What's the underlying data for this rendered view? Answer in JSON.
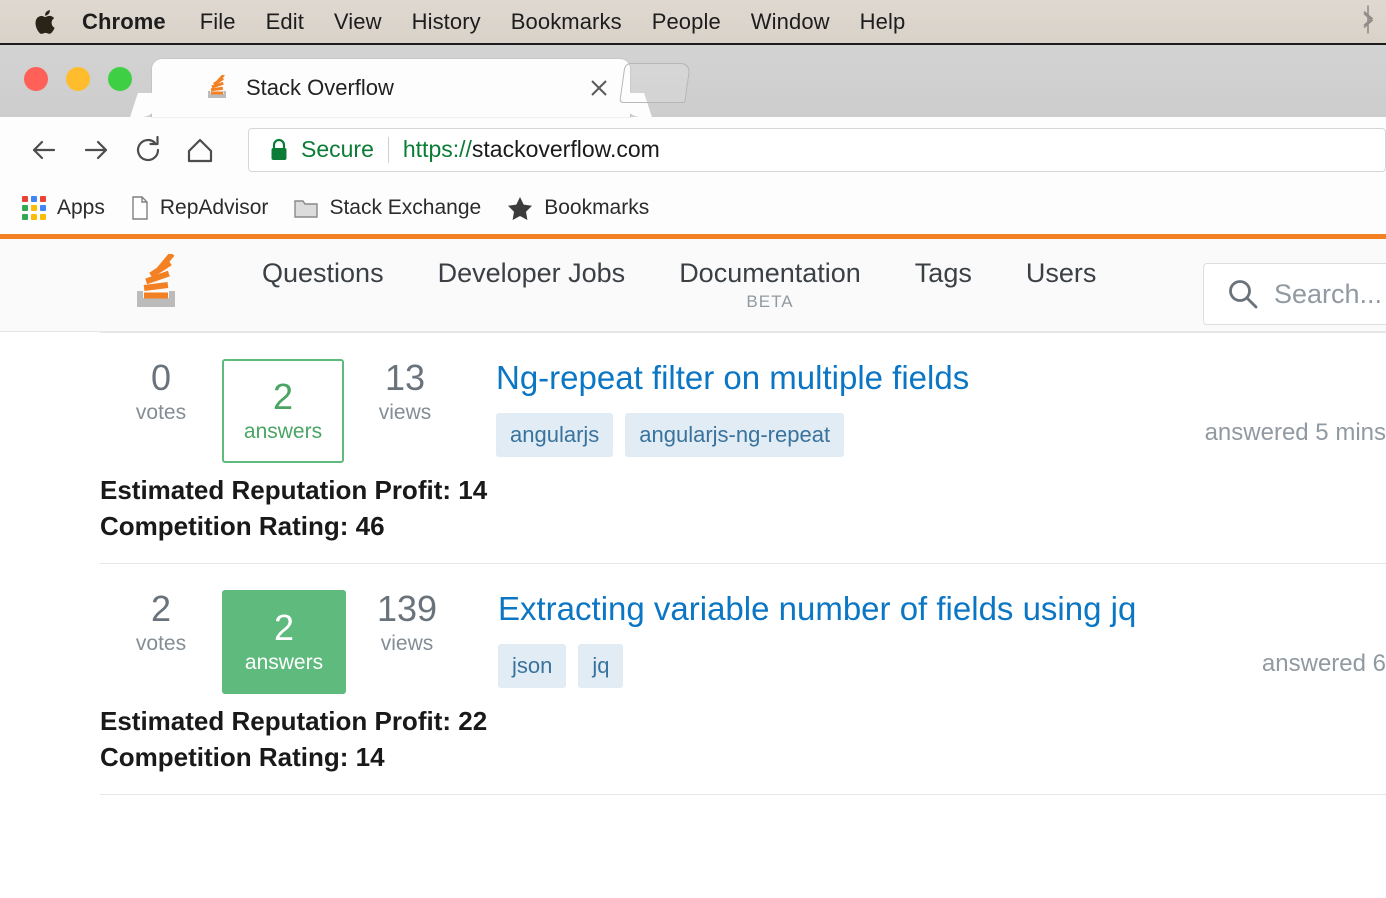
{
  "os_menubar": {
    "apple_icon": "apple-logo",
    "items": [
      {
        "label": "Chrome",
        "bold": true
      },
      {
        "label": "File",
        "bold": false
      },
      {
        "label": "Edit",
        "bold": false
      },
      {
        "label": "View",
        "bold": false
      },
      {
        "label": "History",
        "bold": false
      },
      {
        "label": "Bookmarks",
        "bold": false
      },
      {
        "label": "People",
        "bold": false
      },
      {
        "label": "Window",
        "bold": false
      },
      {
        "label": "Help",
        "bold": false
      }
    ],
    "status_icon": "bluetooth-icon"
  },
  "browser": {
    "tab": {
      "title": "Stack Overflow",
      "favicon": "stack-overflow-favicon",
      "close_icon": "close-icon"
    },
    "new_tab_label": "",
    "toolbar": {
      "back_icon": "back-arrow-icon",
      "forward_icon": "forward-arrow-icon",
      "reload_icon": "reload-icon",
      "home_icon": "home-icon"
    },
    "omnibox": {
      "lock_icon": "lock-icon",
      "security_label": "Secure",
      "url_scheme": "https://",
      "url_host": "stackoverflow.com",
      "secure_color": "#0b7c36"
    },
    "bookmarks": [
      {
        "label": "Apps",
        "icon": "apps-grid-icon"
      },
      {
        "label": "RepAdvisor",
        "icon": "document-icon"
      },
      {
        "label": "Stack Exchange",
        "icon": "folder-icon"
      },
      {
        "label": "Bookmarks",
        "icon": "star-icon"
      }
    ]
  },
  "site": {
    "accent_color": "#f48024",
    "logo": "stack-overflow-logo",
    "nav": [
      {
        "label": "Questions",
        "sub": ""
      },
      {
        "label": "Developer Jobs",
        "sub": ""
      },
      {
        "label": "Documentation",
        "sub": "BETA"
      },
      {
        "label": "Tags",
        "sub": ""
      },
      {
        "label": "Users",
        "sub": ""
      }
    ],
    "search": {
      "icon": "search-icon",
      "placeholder": "Search..."
    }
  },
  "questions": [
    {
      "votes": "0",
      "votes_label": "votes",
      "answers": "2",
      "answers_label": "answers",
      "answers_state": "outline",
      "views": "13",
      "views_label": "views",
      "title": "Ng-repeat filter on multiple fields",
      "tags": [
        "angularjs",
        "angularjs-ng-repeat"
      ],
      "meta": "answered 5 mins",
      "annotation_profit": "Estimated Reputation Profit: 14",
      "annotation_competition": "Competition Rating: 46"
    },
    {
      "votes": "2",
      "votes_label": "votes",
      "answers": "2",
      "answers_label": "answers",
      "answers_state": "solid",
      "views": "139",
      "views_label": "views",
      "title": "Extracting variable number of fields using jq",
      "tags": [
        "json",
        "jq"
      ],
      "meta": "answered 6",
      "annotation_profit": "Estimated Reputation Profit: 22",
      "annotation_competition": "Competition Rating: 14"
    }
  ]
}
